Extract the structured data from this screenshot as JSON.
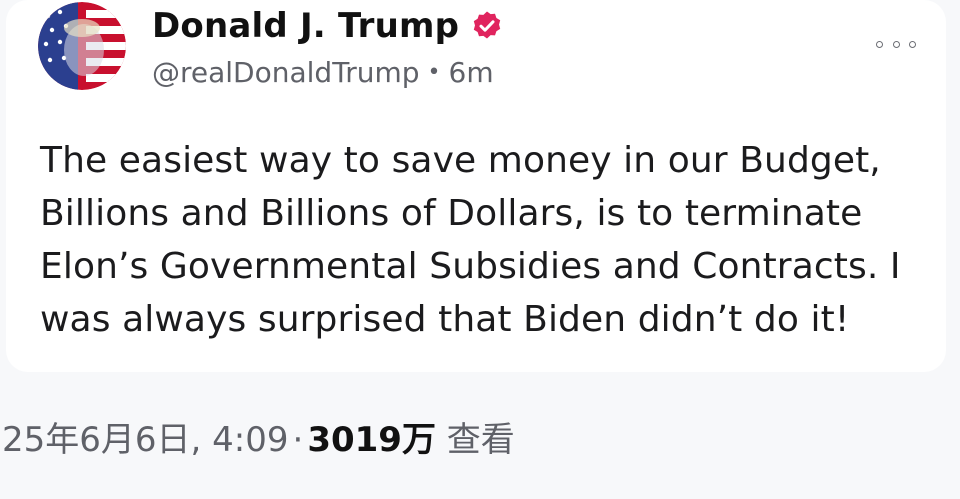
{
  "post": {
    "author": {
      "display_name": "Donald J. Trump",
      "handle": "@realDonaldTrump",
      "verified_icon": "verified-badge-icon",
      "avatar_icon": "profile-avatar"
    },
    "separator": "•",
    "time_ago": "6m",
    "more_icon": "more-options-icon",
    "text": "The easiest way to save money in our Budget, Billions and Billions of Dollars, is to terminate Elon’s Governmental Subsidies and Contracts. I was always surprised that Biden didn’t do it!"
  },
  "footer": {
    "timestamp": "25年6月6日, 4:09",
    "separator": "·",
    "views_count": "3019万",
    "views_label": "查看"
  },
  "colors": {
    "verified_badge": "#e0245e",
    "text_primary": "#111111",
    "text_secondary": "#5f6168",
    "card_background": "#ffffff",
    "page_background": "#f7f8fa"
  }
}
